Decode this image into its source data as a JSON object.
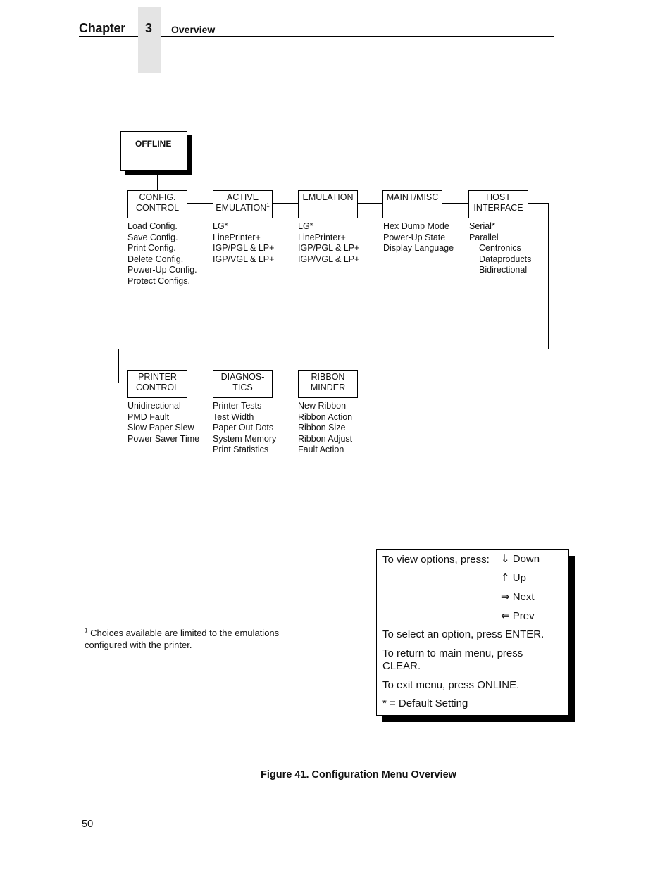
{
  "header": {
    "chapter_label": "Chapter",
    "chapter_number": "3",
    "section_title": "Overview"
  },
  "diagram": {
    "root": "OFFLINE",
    "row1": [
      {
        "title_line1": "CONFIG.",
        "title_line2": "CONTROL",
        "options": [
          "Load Config.",
          "Save Config.",
          "Print Config.",
          "Delete Config.",
          "Power-Up Config.",
          "Protect Configs."
        ]
      },
      {
        "title_line1": "ACTIVE",
        "title_line2": "EMULATION",
        "footnote_mark": "1",
        "options": [
          "LG*",
          "LinePrinter+",
          "IGP/PGL & LP+",
          "IGP/VGL & LP+"
        ]
      },
      {
        "title_line1": "EMULATION",
        "title_line2": "",
        "options": [
          "LG*",
          "LinePrinter+",
          "IGP/PGL & LP+",
          "IGP/VGL & LP+"
        ]
      },
      {
        "title_line1": "MAINT/MISC",
        "title_line2": "",
        "options": [
          "Hex Dump Mode",
          "Power-Up State",
          "Display Language"
        ]
      },
      {
        "title_line1": "HOST",
        "title_line2": "INTERFACE",
        "options": [
          "Serial*",
          "Parallel"
        ],
        "sub_options": [
          "Centronics",
          "Dataproducts",
          "Bidirectional"
        ]
      }
    ],
    "row2": [
      {
        "title_line1": "PRINTER",
        "title_line2": "CONTROL",
        "options": [
          "Unidirectional",
          "PMD Fault",
          "Slow Paper Slew",
          "Power Saver Time"
        ]
      },
      {
        "title_line1": "DIAGNOS-",
        "title_line2": "TICS",
        "options": [
          "Printer Tests",
          "Test Width",
          "Paper Out Dots",
          "System Memory",
          "Print Statistics"
        ]
      },
      {
        "title_line1": "RIBBON",
        "title_line2": "MINDER",
        "options": [
          "New Ribbon",
          "Ribbon Action",
          "Ribbon Size",
          "Ribbon Adjust",
          "Fault Action"
        ]
      }
    ]
  },
  "legend": {
    "view_label": "To view options, press:",
    "keys": [
      {
        "icon": "⇓",
        "label": "Down"
      },
      {
        "icon": "⇑",
        "label": "Up"
      },
      {
        "icon": "⇒",
        "label": "Next"
      },
      {
        "icon": "⇐",
        "label": "Prev"
      }
    ],
    "select_text": "To select an option, press ENTER.",
    "return_text_line1": "To return to main menu, press",
    "return_text_line2": "CLEAR.",
    "exit_text": "To exit menu, press ONLINE.",
    "default_text": "* = Default Setting"
  },
  "footnote": {
    "mark": "1",
    "text_line1": " Choices available are limited to the emulations",
    "text_line2": "configured with the printer."
  },
  "caption": "Figure 41. Configuration Menu Overview",
  "page_number": "50"
}
